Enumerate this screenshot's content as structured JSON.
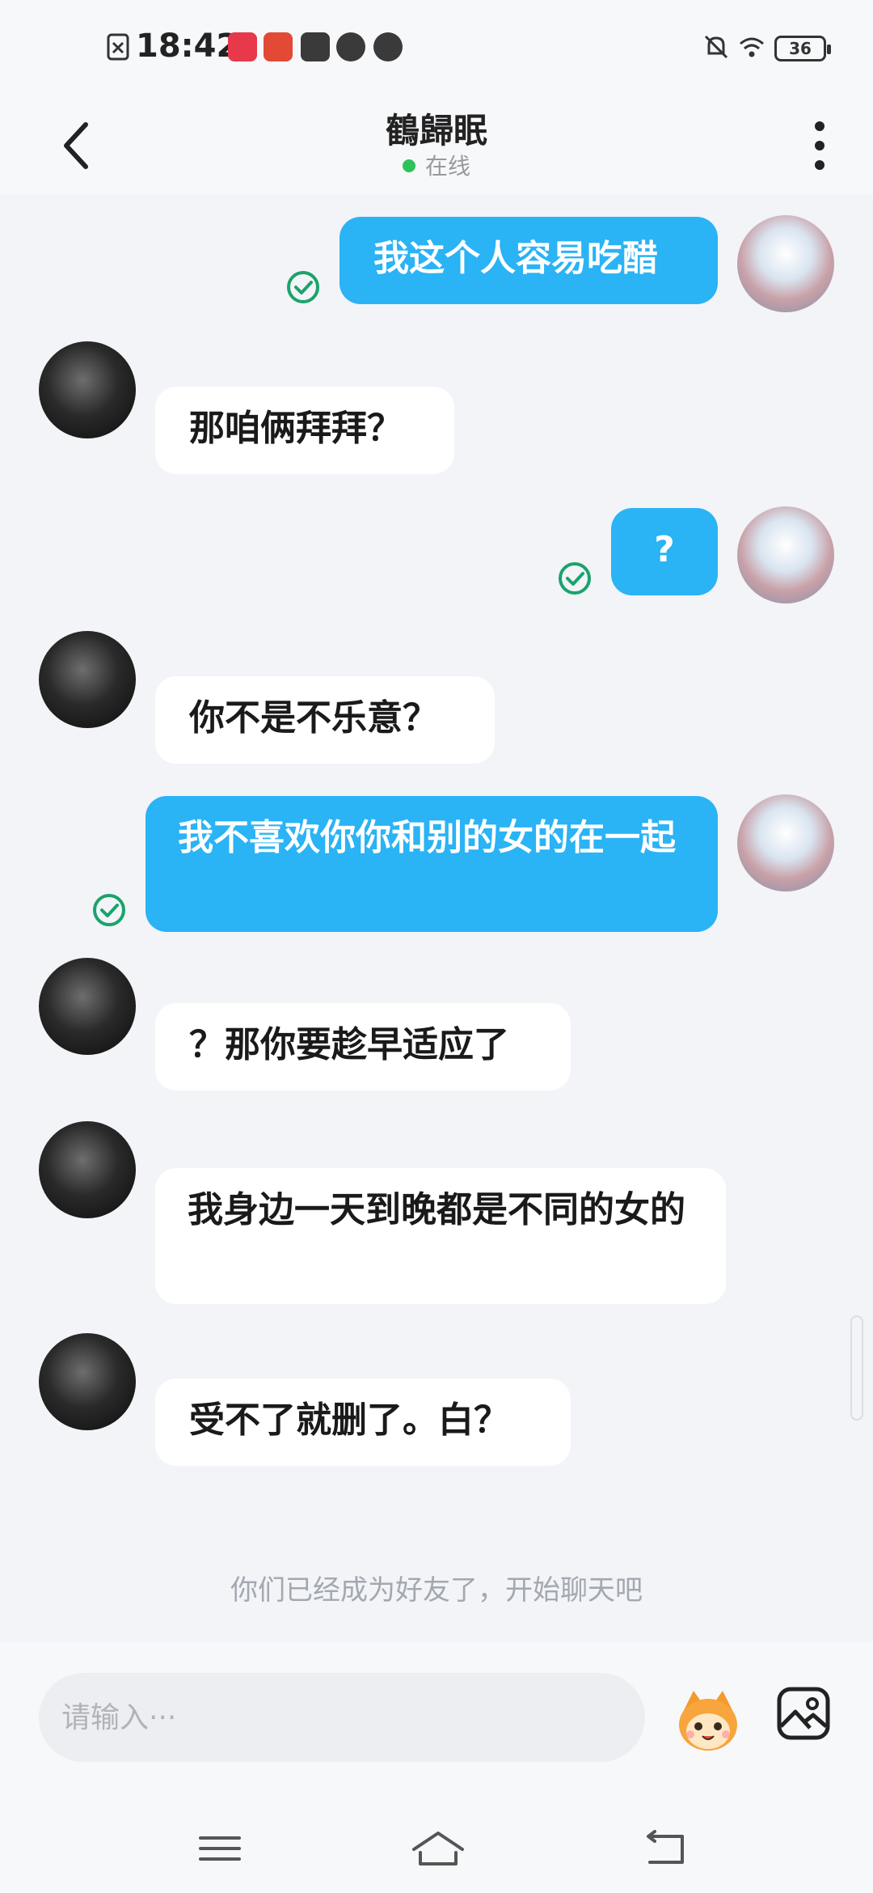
{
  "status_bar": {
    "time": "18:42",
    "battery": "36"
  },
  "header": {
    "title": "鶴歸眠",
    "status": "在线"
  },
  "messages": [
    {
      "text": "我这个人容易吃醋"
    },
    {
      "text": "那咱俩拜拜？"
    },
    {
      "text": "?"
    },
    {
      "text": "你不是不乐意？"
    },
    {
      "text": "我不喜欢你你和别的女的在一起"
    },
    {
      "text": "？那你要趁早适应了"
    },
    {
      "text": "我身边一天到晚都是不同的女的"
    },
    {
      "text": "受不了就删了。白？"
    }
  ],
  "system_note": "你们已经成为好友了，开始聊天吧",
  "input": {
    "placeholder": "请输入···"
  },
  "colors": {
    "outgoing_bubble": "#2ab3f5",
    "incoming_bubble": "#ffffff",
    "read_check": "#1aa36b",
    "online": "#2fc25b"
  },
  "icons": [
    "back-icon",
    "more-icon",
    "read-check-icon",
    "emoji-icon",
    "image-icon",
    "menu-icon",
    "home-icon",
    "back-nav-icon"
  ]
}
